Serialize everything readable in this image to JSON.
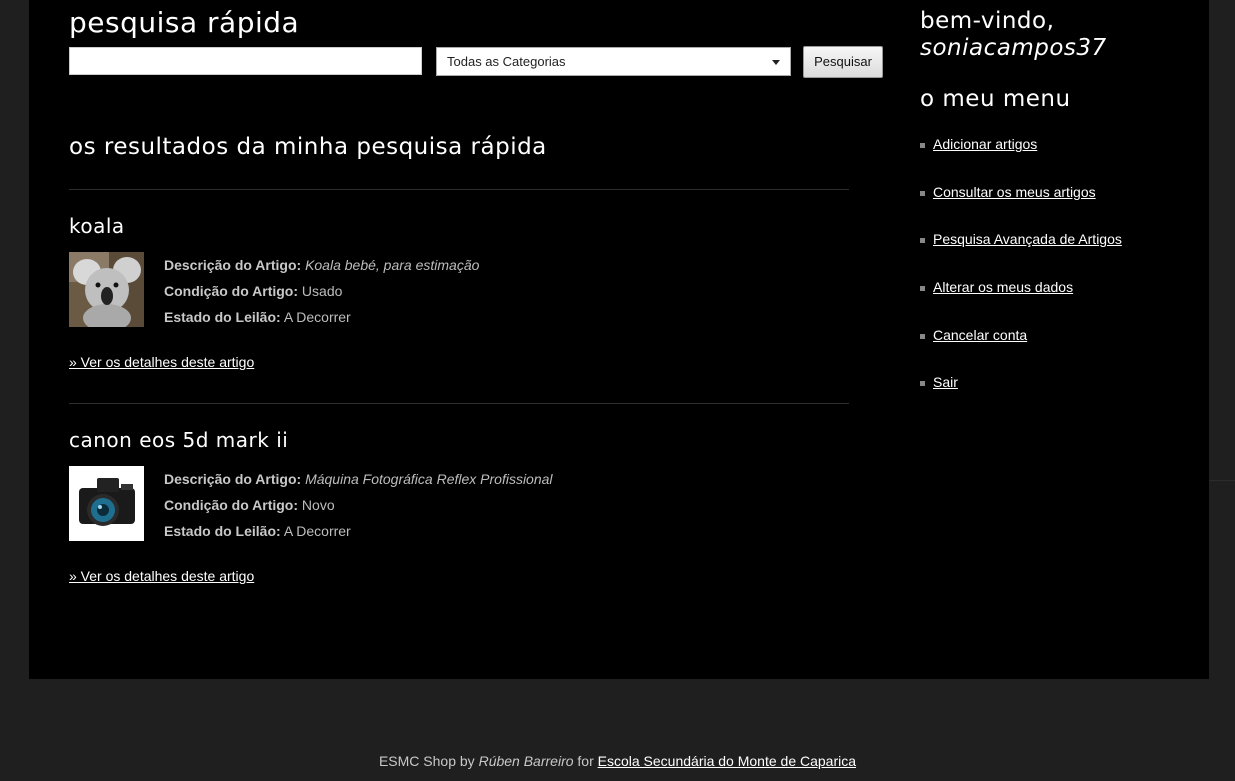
{
  "search": {
    "title": "pesquisa rápida",
    "input_value": "",
    "category_selected": "Todas as Categorias",
    "button_label": "Pesquisar"
  },
  "results": {
    "title": "os resultados da minha pesquisa rápida",
    "items": [
      {
        "name": "koala",
        "description_label": "Descrição do Artigo:",
        "description": "Koala bebé, para estimação",
        "condition_label": "Condição do Artigo:",
        "condition": "Usado",
        "status_label": "Estado do Leilão:",
        "status": "A Decorrer",
        "details_link": "» Ver os detalhes deste artigo"
      },
      {
        "name": "canon eos 5d mark ii",
        "description_label": "Descrição do Artigo:",
        "description": "Máquina Fotográfica Reflex Profissional",
        "condition_label": "Condição do Artigo:",
        "condition": "Novo",
        "status_label": "Estado do Leilão:",
        "status": "A Decorrer",
        "details_link": "» Ver os detalhes deste artigo"
      }
    ]
  },
  "sidebar": {
    "welcome": "bem-vindo,",
    "username": "soniacampos37",
    "menu_title": "o meu menu",
    "menu_items": [
      "Adicionar artigos",
      "Consultar os meus artigos",
      "Pesquisa Avançada de Artigos",
      "Alterar os meus dados",
      "Cancelar conta",
      "Sair"
    ]
  },
  "footer": {
    "prefix": "ESMC Shop by",
    "author": "Rúben Barreiro",
    "middle": "for",
    "school_link": "Escola Secundária do Monte de Caparica"
  },
  "colors": {
    "page_bg": "#1f1f1f",
    "panel_bg": "#000000",
    "text": "#bdbdbd",
    "heading": "#ffffff"
  }
}
